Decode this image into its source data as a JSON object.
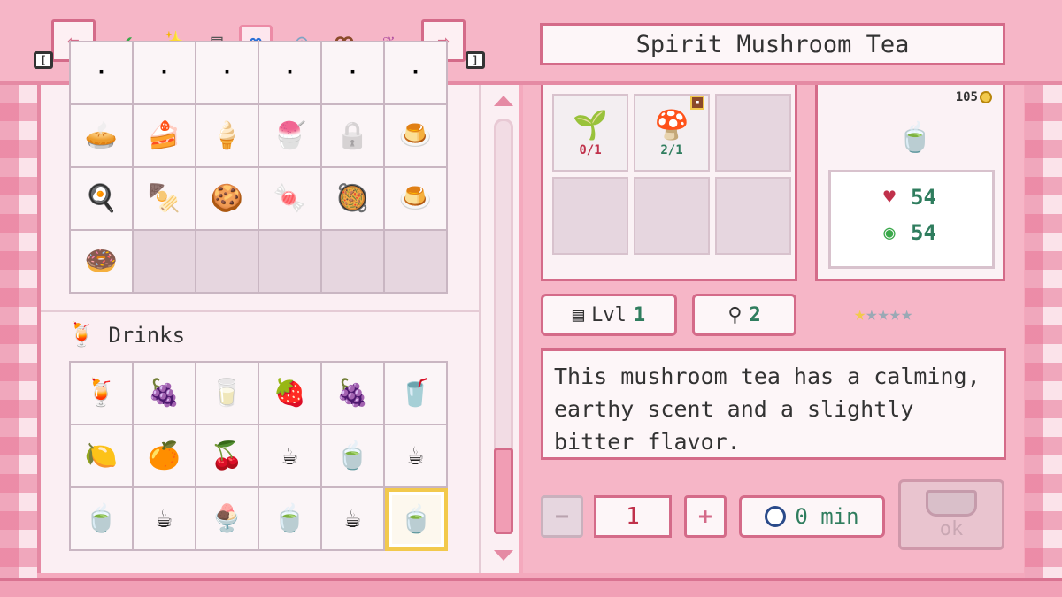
{
  "header": {
    "recipe_title": "Spirit Mushroom Tea",
    "nav_left_key": "[",
    "nav_right_key": "]",
    "categories": [
      {
        "icon": "checkmark-icon",
        "glyph": "✔"
      },
      {
        "icon": "sparkle-icon",
        "glyph": "✨"
      },
      {
        "icon": "stove-icon",
        "glyph": "▤"
      },
      {
        "icon": "infinity-icon",
        "glyph": "∞"
      },
      {
        "icon": "dumplings-icon",
        "glyph": "◎"
      },
      {
        "icon": "pretzel-icon",
        "glyph": "ꝏ"
      },
      {
        "icon": "salad-icon",
        "glyph": "❦"
      }
    ]
  },
  "recipe_list": {
    "section_label": "Drinks",
    "food_icons": [
      "🥧",
      "🍰",
      "🍦",
      "🍧",
      "🔒",
      "🍮",
      "🍳",
      "🍢",
      "🍪",
      "🍬",
      "🥘",
      "🍮",
      "🍩"
    ],
    "drink_icons": [
      "🍹",
      "🍇",
      "🥛",
      "🍓",
      "🍇",
      "🥤",
      "🍋",
      "🍊",
      "🍒",
      "☕",
      "🍵",
      "☕",
      "🍵",
      "☕",
      "🍨",
      "🍵",
      "☕",
      "🍵"
    ]
  },
  "ingredients": [
    {
      "icon": "herb-sprout-icon",
      "glyph": "🌱",
      "count": "0/1",
      "state": "bad"
    },
    {
      "icon": "blue-mushroom-icon",
      "glyph": "🍄",
      "count": "2/1",
      "state": "good"
    }
  ],
  "stats": {
    "price": "105",
    "health": "54",
    "energy": "54"
  },
  "meta": {
    "level_label": "Lvl",
    "level_value": "1",
    "tool_value": "2",
    "stars_on": 1,
    "stars_total": 5
  },
  "description": "This mushroom tea has a calming, earthy scent and a slightly bitter flavor.",
  "cook": {
    "quantity": "1",
    "minus": "−",
    "plus": "+",
    "time": "0 min",
    "ok_label": "ok"
  },
  "colors": {
    "accent": "#d46b89",
    "background": "#f6b6c7",
    "good": "#2f7d5e",
    "bad": "#c0314b",
    "gold": "#f2c94c"
  }
}
